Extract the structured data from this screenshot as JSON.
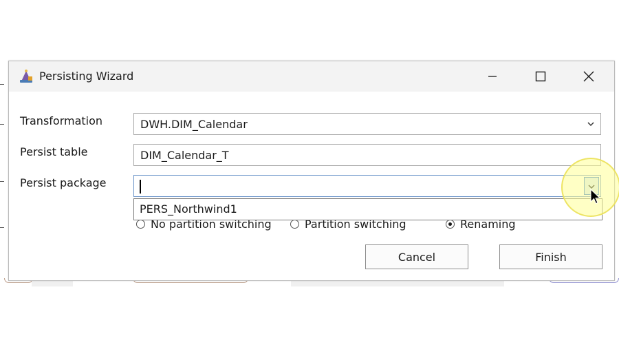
{
  "window": {
    "title": "Persisting Wizard",
    "app_icon": "wizard-app-icon"
  },
  "titlebar_controls": [
    "minimize-icon",
    "maximize-icon",
    "close-icon"
  ],
  "form": {
    "transformation": {
      "label": "Transformation",
      "value": "DWH.DIM_Calendar"
    },
    "persist_table": {
      "label": "Persist table",
      "value": "DIM_Calendar_T"
    },
    "persist_package": {
      "label": "Persist package",
      "value": "",
      "options": [
        "PERS_Northwind1"
      ]
    }
  },
  "mode_options": [
    {
      "label": "No partition switching",
      "selected": false
    },
    {
      "label": "Partition switching",
      "selected": false
    },
    {
      "label": "Renaming",
      "selected": true
    }
  ],
  "buttons": {
    "cancel": "Cancel",
    "finish": "Finish"
  }
}
